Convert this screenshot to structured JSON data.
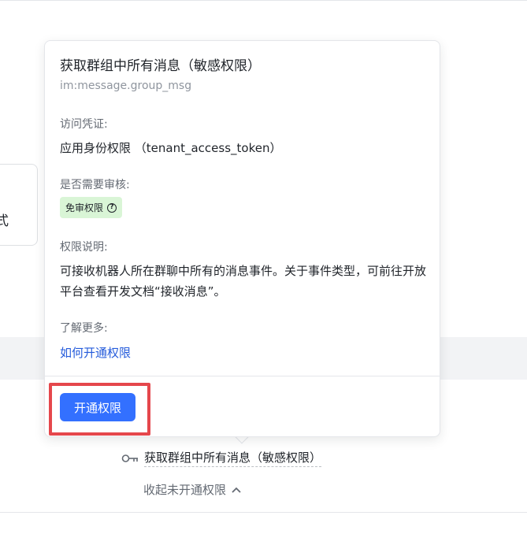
{
  "background": {
    "card_partial_text": "式"
  },
  "popover": {
    "title": "获取群组中所有消息（敏感权限）",
    "code": "im:message.group_msg",
    "credential_label": "访问凭证:",
    "credential_value": "应用身份权限 （tenant_access_token）",
    "review_label": "是否需要审核:",
    "review_badge": "免审权限",
    "review_badge_icon": "help-circle-icon",
    "description_label": "权限说明:",
    "description": "可接收机器人所在群聊中所有的消息事件。关于事件类型，可前往开放平台查看开发文档“接收消息”。",
    "learn_more_label": "了解更多:",
    "learn_more_link": "如何开通权限",
    "enable_button": "开通权限"
  },
  "permission_list": {
    "item_icon": "key-icon",
    "item_label": "获取群组中所有消息（敏感权限）",
    "collapse_label": "收起未开通权限",
    "collapse_icon": "chevron-up-icon"
  },
  "colors": {
    "primary": "#3370ff",
    "link": "#245bdb",
    "badge_bg": "#d9f5d6",
    "highlight": "#e5474c"
  }
}
